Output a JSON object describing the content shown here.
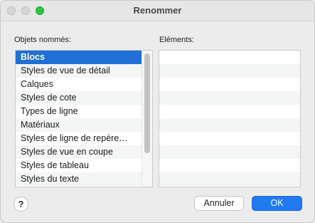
{
  "window": {
    "title": "Renommer"
  },
  "left_panel": {
    "label": "Objets nommés:",
    "items": [
      "Blocs",
      "Styles de vue de détail",
      "Calques",
      "Styles de cote",
      "Types de ligne",
      "Matériaux",
      "Styles de ligne de repère…",
      "Styles de vue en coupe",
      "Styles de tableau",
      "Styles du texte"
    ],
    "selected_index": 0
  },
  "right_panel": {
    "label": "Eléments:"
  },
  "buttons": {
    "help": "?",
    "cancel": "Annuler",
    "ok": "OK"
  },
  "colors": {
    "selection": "#1f6fd6",
    "ok_button": "#1f7aef",
    "zoom_light": "#2bc840"
  }
}
